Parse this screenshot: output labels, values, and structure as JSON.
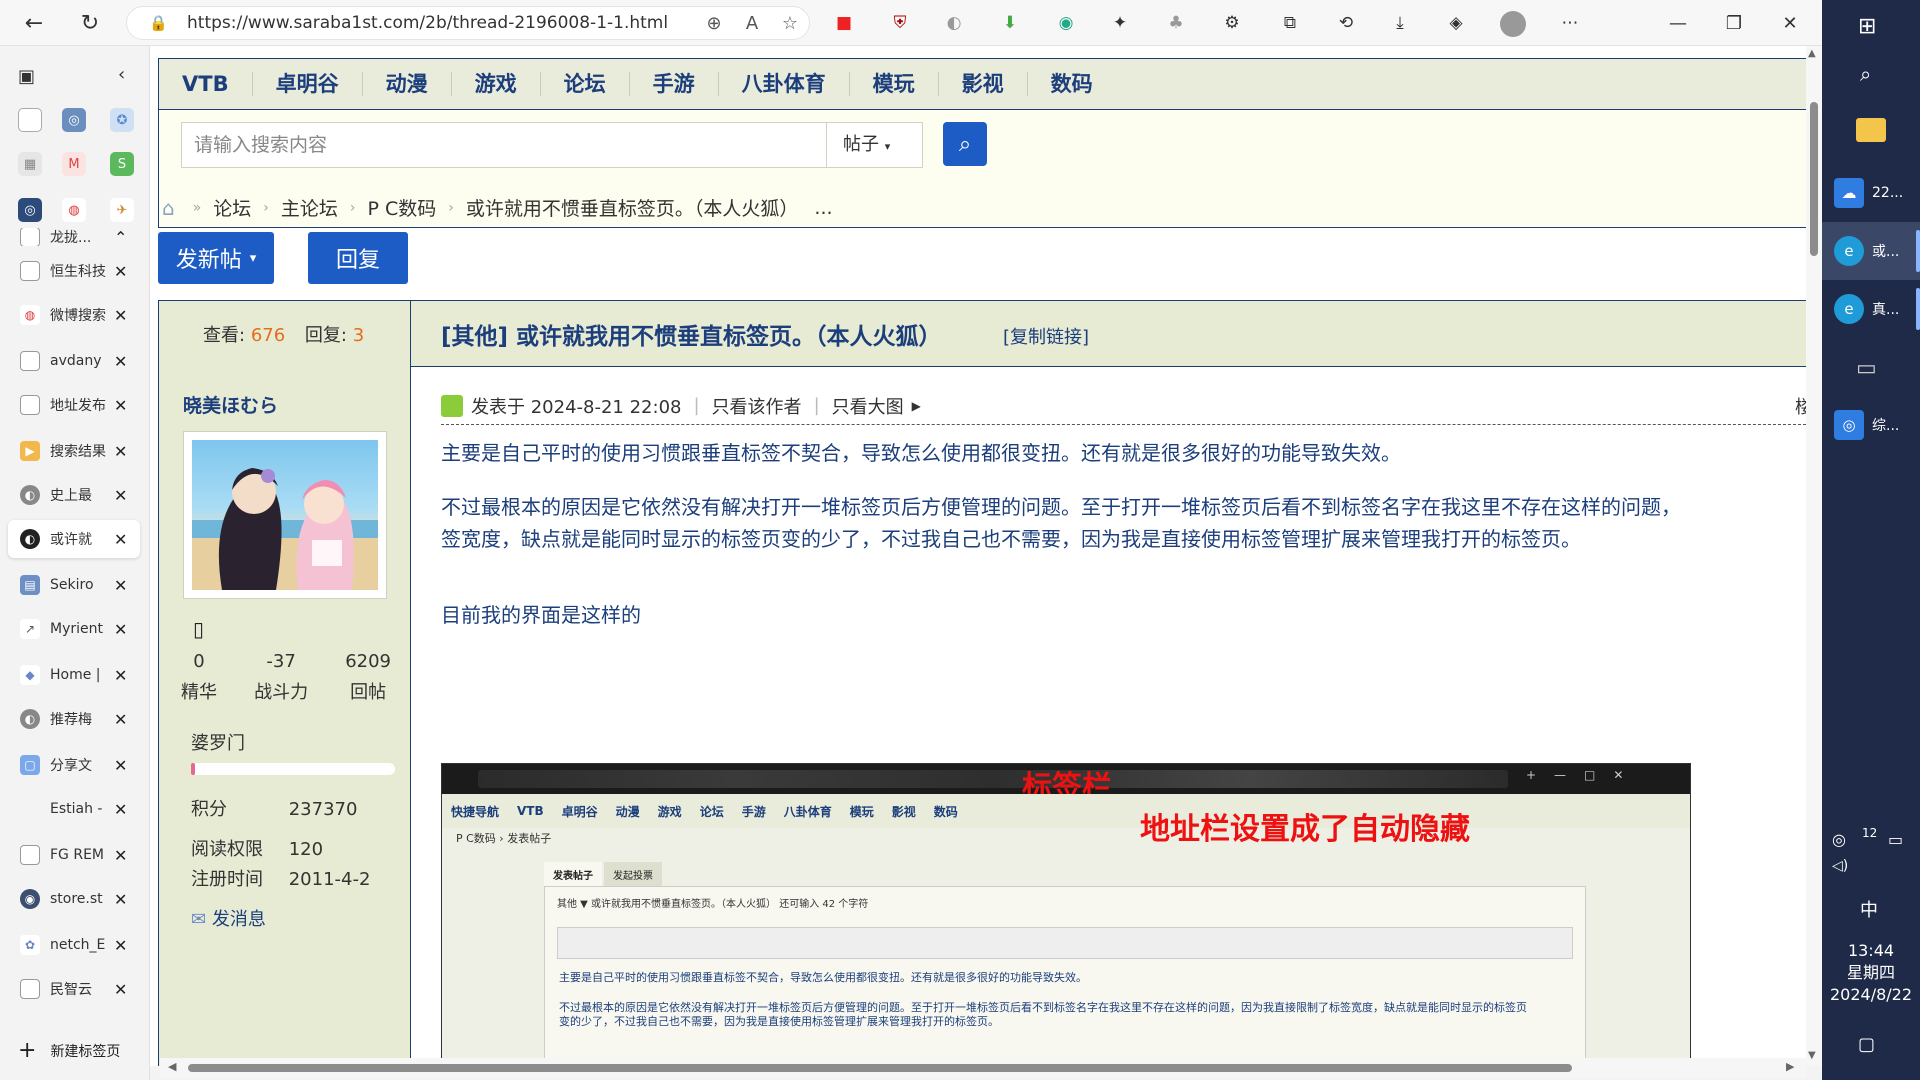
{
  "browser": {
    "url": "https://www.saraba1st.com/2b/thread-2196008-1-1.html"
  },
  "tabs": [
    {
      "label": "龙拢..."
    },
    {
      "label": "恒生科技"
    },
    {
      "label": "微博搜索"
    },
    {
      "label": "avdany"
    },
    {
      "label": "地址发布"
    },
    {
      "label": "搜索结果"
    },
    {
      "label": "史上最"
    },
    {
      "label": "或许就"
    },
    {
      "label": "Sekiro"
    },
    {
      "label": "Myrient"
    },
    {
      "label": "Home |"
    },
    {
      "label": "推荐梅"
    },
    {
      "label": "分享文"
    },
    {
      "label": "Estiah -"
    },
    {
      "label": "FG REM"
    },
    {
      "label": "store.st"
    },
    {
      "label": "netch_E"
    },
    {
      "label": "民智云"
    }
  ],
  "new_tab_label": "新建标签页",
  "site": {
    "nav": [
      "VTB",
      "卓明谷",
      "动漫",
      "游戏",
      "论坛",
      "手游",
      "八卦体育",
      "模玩",
      "影视",
      "数码"
    ],
    "search_placeholder": "请输入搜索内容",
    "search_type": "帖子",
    "breadcrumb": [
      "论坛",
      "主论坛",
      "P C数码",
      "或许就用不惯垂直标签页。（本人火狐）",
      "..."
    ],
    "new_post_label": "发新帖",
    "reply_label": "回复"
  },
  "thread": {
    "views_label": "查看:",
    "views": "676",
    "replies_label": "回复:",
    "replies": "3",
    "title": "[其他] 或许就我用不惯垂直标签页。（本人火狐）",
    "copy_link": "[复制链接]"
  },
  "author": {
    "name": "晓美ほむら",
    "stats": [
      {
        "value": "0",
        "label": "精华"
      },
      {
        "value": "-37",
        "label": "战斗力"
      },
      {
        "value": "6209",
        "label": "回帖"
      }
    ],
    "group": "婆罗门",
    "progress": 0.02,
    "points_label": "积分",
    "points": "237370",
    "read_label": "阅读权限",
    "read": "120",
    "reg_label": "注册时间",
    "reg": "2011-4-2",
    "message_label": "发消息"
  },
  "post": {
    "posted": "发表于 2024-8-21 22:08",
    "only_author": "只看该作者",
    "only_big": "只看大图",
    "floor": "楼主",
    "p1": "主要是自己平时的使用习惯跟垂直标签不契合，导致怎么使用都很变扭。还有就是很多很好的功能导致失效。",
    "p2a": "不过最根本的原因是它依然没有解决打开一堆标签页后方便管理的问题。至于打开一堆标签页后看不到标签名字在我这里不存在这样的问题，",
    "p2b": "签宽度，缺点就是能同时显示的标签页变的少了，不过我自己也不需要，因为我是直接使用标签管理扩展来管理我打开的标签页。",
    "p3": "目前我的界面是这样的"
  },
  "screenshot": {
    "label_tabs": "标签栏",
    "label_address": "地址栏设置成了自动隐藏",
    "nav": [
      "快捷导航",
      "VTB",
      "卓明谷",
      "动漫",
      "游戏",
      "论坛",
      "手游",
      "八卦体育",
      "模玩",
      "影视",
      "数码"
    ],
    "crumb": "P C数码 › 发表帖子",
    "tab1": "发表帖子",
    "tab2": "发起投票",
    "row1": "其他 ▼   或许就我用不惯垂直标签页。（本人火狐）        还可输入 42 个字符",
    "line1": "主要是自己平时的使用习惯跟垂直标签不契合，导致怎么使用都很变扭。还有就是很多很好的功能导致失效。",
    "line2": "不过最根本的原因是它依然没有解决打开一堆标签页后方便管理的问题。至于打开一堆标签页后看不到标签名字在我这里不存在这样的问题，因为我直接限制了标签宽度，缺点就是能同时显示的标签页",
    "line3": "变的少了，不过我自己也不需要，因为我是直接使用标签管理扩展来管理我打开的标签页。"
  },
  "taskbar": {
    "items": [
      "22...",
      "或...",
      "真...",
      "综..."
    ],
    "ime": "中",
    "time": "13:44",
    "weekday": "星期四",
    "date": "2024/8/22",
    "tray_num": "12"
  }
}
